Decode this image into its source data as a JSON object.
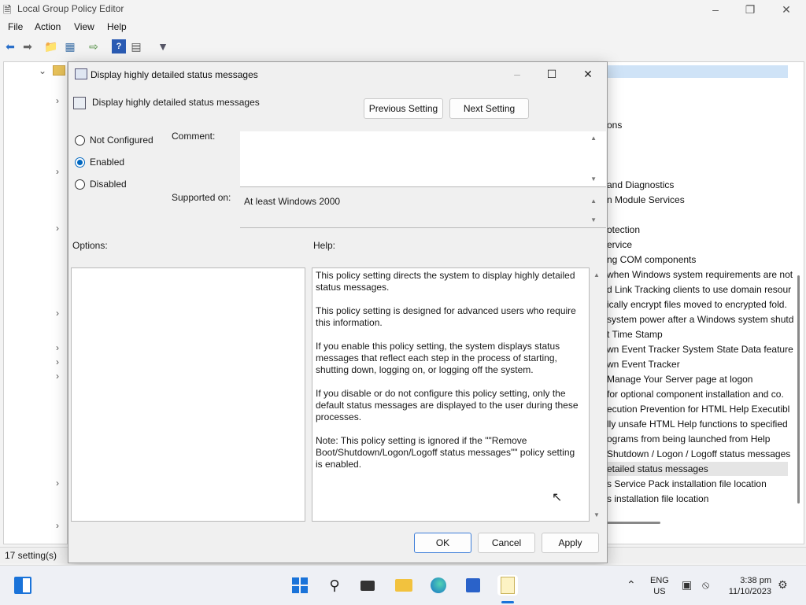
{
  "window": {
    "title": "Local Group Policy Editor"
  },
  "menu": [
    "File",
    "Action",
    "View",
    "Help"
  ],
  "list_items": [
    "ons",
    "and Diagnostics",
    "n Module Services",
    "otection",
    "ervice",
    "ng COM components",
    "when Windows system requirements are not",
    "d Link Tracking clients to use domain resour",
    "ically encrypt files moved to encrypted fold.",
    "system power after a Windows system shutd",
    "t Time Stamp",
    "wn Event Tracker System State Data feature",
    "wn Event Tracker",
    "Manage Your Server page at logon",
    "for optional component installation and co.",
    "ecution Prevention for HTML Help Executibl",
    "lly unsafe HTML Help functions to specified",
    "ograms from being launched from Help",
    "Shutdown / Logon / Logoff status messages",
    "etailed status messages",
    "s Service Pack installation file location",
    "s installation file location"
  ],
  "status": {
    "text": "17 setting(s)"
  },
  "dialog": {
    "title": "Display highly detailed status messages",
    "setting_name": "Display highly detailed status messages",
    "prev_label": "Previous Setting",
    "next_label": "Next Setting",
    "radios": {
      "not_configured": "Not Configured",
      "enabled": "Enabled",
      "disabled": "Disabled"
    },
    "selected": "Enabled",
    "comment_label": "Comment:",
    "supported_label": "Supported on:",
    "supported_value": "At least Windows 2000",
    "options_label": "Options:",
    "help_label": "Help:",
    "help_paragraphs": [
      "This policy setting directs the system to display highly detailed status messages.",
      "This policy setting is designed for advanced users who require this information.",
      "If you enable this policy setting, the system displays status messages that reflect each step in the process of starting, shutting down, logging on, or logging off the system.",
      "If you disable or do not configure this policy setting, only the default status messages are displayed to the user during these processes.",
      "Note: This policy setting is ignored if the \"\"Remove Boot/Shutdown/Logon/Logoff status messages\"\" policy setting is enabled."
    ],
    "ok_label": "OK",
    "cancel_label": "Cancel",
    "apply_label": "Apply"
  },
  "tray": {
    "lang": "ENG",
    "region": "US",
    "time": "3:38 pm",
    "date": "11/10/2023"
  },
  "icons": {
    "taskbar": [
      "start-icon",
      "search-icon",
      "task-view-icon",
      "file-explorer-icon",
      "edge-icon",
      "store-icon",
      "notepad-icon"
    ],
    "accent": "#0067c0"
  }
}
